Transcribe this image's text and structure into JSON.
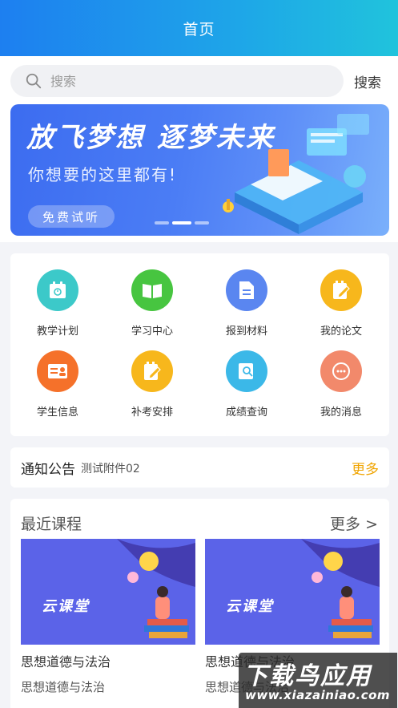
{
  "header": {
    "title": "首页"
  },
  "search": {
    "placeholder": "搜索",
    "button_label": "搜索"
  },
  "banner": {
    "title": "放飞梦想 逐梦未来",
    "subtitle": "你想要的这里都有!",
    "button_label": "免费试听",
    "slide_count": 3,
    "active_slide": 2
  },
  "menu": {
    "items": [
      {
        "label": "教学计划",
        "icon": "calendar-icon",
        "color": "#3cc9c9"
      },
      {
        "label": "学习中心",
        "icon": "book-icon",
        "color": "#47c540"
      },
      {
        "label": "报到材料",
        "icon": "document-icon",
        "color": "#5a86f0"
      },
      {
        "label": "我的论文",
        "icon": "edit-note-icon",
        "color": "#f7b71c"
      },
      {
        "label": "学生信息",
        "icon": "id-card-icon",
        "color": "#f5712a"
      },
      {
        "label": "补考安排",
        "icon": "edit-note-icon",
        "color": "#f7b71c"
      },
      {
        "label": "成绩查询",
        "icon": "search-document-icon",
        "color": "#3bb8e8"
      },
      {
        "label": "我的消息",
        "icon": "chat-bubble-icon",
        "color": "#f2896b"
      }
    ]
  },
  "notice": {
    "title": "通知公告",
    "text": "测试附件02",
    "more_label": "更多"
  },
  "courses": {
    "title": "最近课程",
    "more_label": "更多 >",
    "items": [
      {
        "name": "思想道德与法治",
        "teacher": "思想道德与法治",
        "thumb_text": "云课堂"
      },
      {
        "name": "思想道德与法治",
        "teacher": "思想道德与法治",
        "thumb_text": "云课堂"
      }
    ]
  },
  "watermark": {
    "main": "下载鸟应用",
    "url": "www.xiazainiao.com"
  },
  "colors": {
    "header_start": "#1d7ff0",
    "header_end": "#20c3dc",
    "accent_more": "#f0a400"
  }
}
